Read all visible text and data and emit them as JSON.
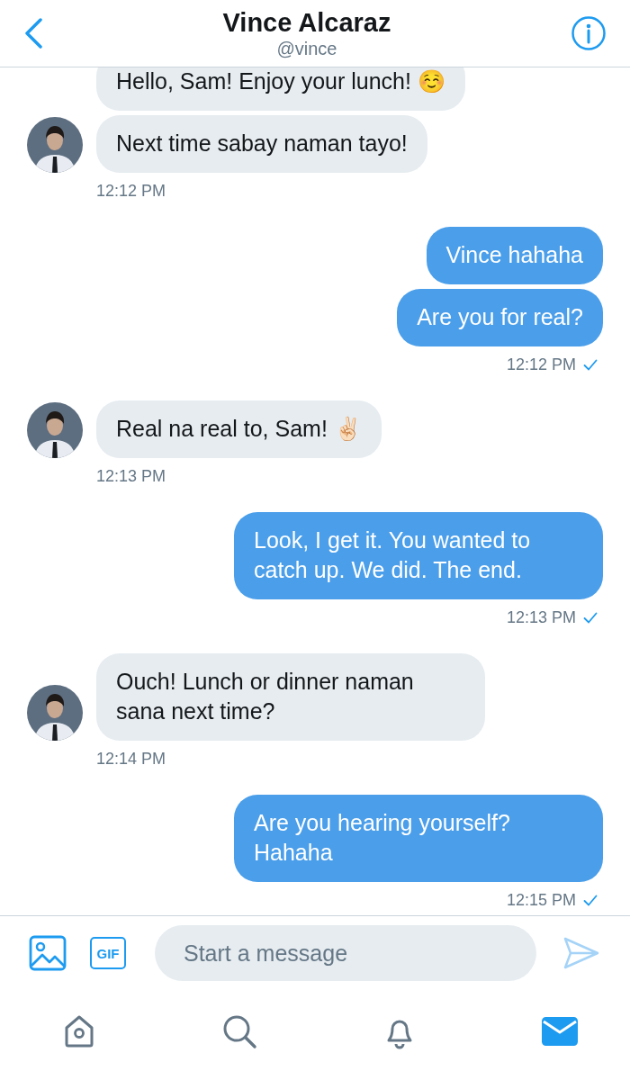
{
  "header": {
    "title": "Vince Alcaraz",
    "handle": "@vince"
  },
  "groups": [
    {
      "kind": "received",
      "bubbles": [
        "Hello, Sam! Enjoy your lunch! ☺️",
        "Next time sabay naman tayo!"
      ],
      "time": "12:12 PM"
    },
    {
      "kind": "sent",
      "bubbles": [
        "Vince hahaha",
        "Are you for real?"
      ],
      "time": "12:12 PM",
      "delivered": true
    },
    {
      "kind": "received",
      "bubbles": [
        "Real na real to, Sam! ✌🏻"
      ],
      "time": "12:13 PM"
    },
    {
      "kind": "sent",
      "bubbles": [
        "Look, I get it. You wanted to catch up. We did. The end."
      ],
      "time": "12:13 PM",
      "delivered": true
    },
    {
      "kind": "received",
      "bubbles": [
        "Ouch! Lunch or dinner naman sana next time?"
      ],
      "time": "12:14 PM"
    },
    {
      "kind": "sent",
      "bubbles": [
        "Are you hearing yourself? Hahaha"
      ],
      "time": "12:15 PM",
      "delivered": true
    }
  ],
  "composer": {
    "gif_label": "GIF",
    "placeholder": "Start a message"
  },
  "tabs": [
    {
      "kind": "home",
      "selected": false
    },
    {
      "kind": "search",
      "selected": false
    },
    {
      "kind": "notifications",
      "selected": false
    },
    {
      "kind": "messages",
      "selected": true
    }
  ]
}
